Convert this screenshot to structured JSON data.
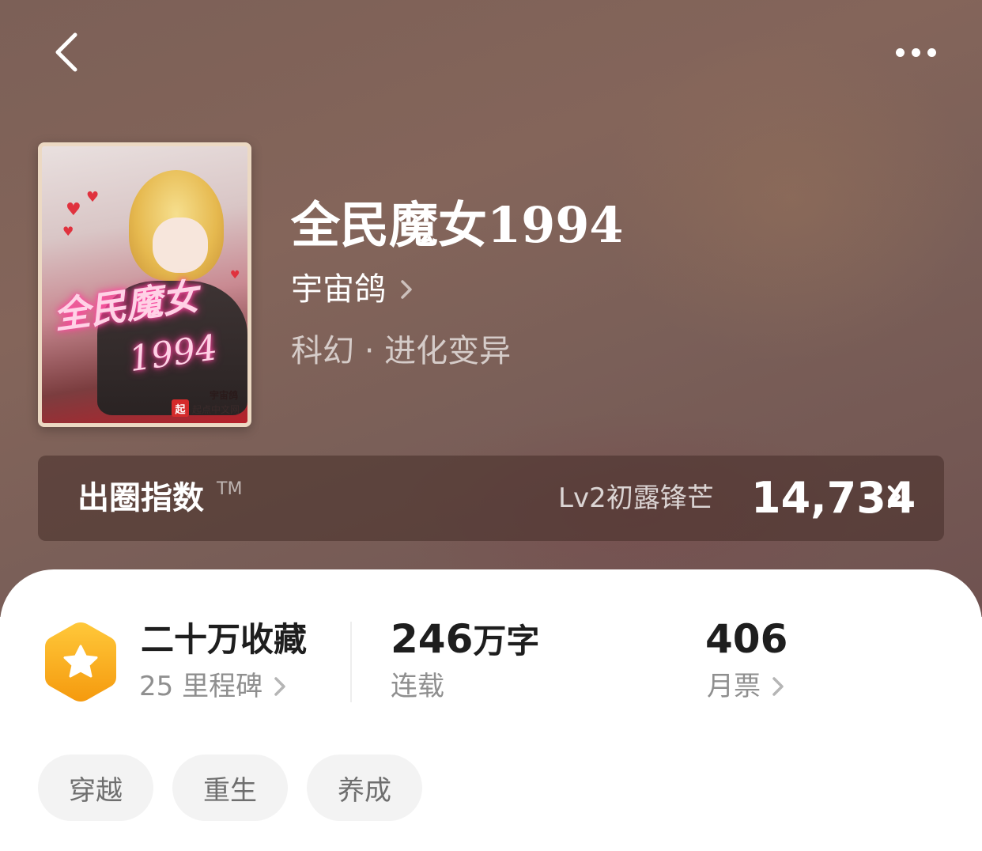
{
  "book": {
    "title": "全民魔女1994",
    "author": "宇宙鸽",
    "genre": "科幻 · 进化变异"
  },
  "cover": {
    "title_line1": "全民魔女",
    "title_line2": "1994",
    "author_mark": "宇宙鸽",
    "publisher_logo": "起",
    "publisher_name": "起点中文网"
  },
  "index_bar": {
    "label": "出圈指数",
    "trademark": "TM",
    "level": "Lv2初露锋芒",
    "value": "14,734"
  },
  "stats": {
    "collection": {
      "title": "二十万收藏",
      "sub": "25 里程碑"
    },
    "words": {
      "number": "246",
      "unit": "万字",
      "sub": "连载"
    },
    "tickets": {
      "number": "406",
      "sub": "月票"
    }
  },
  "tags": [
    "穿越",
    "重生",
    "养成"
  ],
  "colors": {
    "hero_bg": "#7c6057",
    "index_bar_bg": "#5a3f3a",
    "badge": "#f5b020",
    "tag_bg": "#f3f3f3"
  },
  "icons": {
    "back": "chevron-left-icon",
    "more": "more-dots-icon",
    "badge": "star-hexagon-icon",
    "chevron": "chevron-right-icon"
  }
}
